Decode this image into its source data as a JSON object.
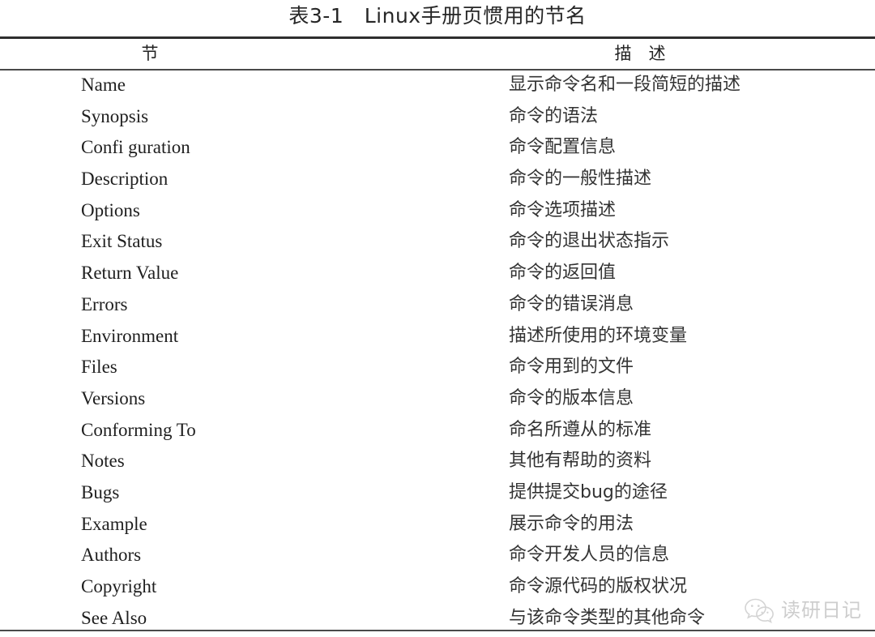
{
  "caption": "表3-1　Linux手册页惯用的节名",
  "table": {
    "headers": {
      "section": "节",
      "description": "描　述"
    },
    "rows": [
      {
        "section": "Name",
        "description": "显示命令名和一段简短的描述"
      },
      {
        "section": "Synopsis",
        "description": "命令的语法"
      },
      {
        "section": "Confi guration",
        "description": "命令配置信息"
      },
      {
        "section": "Description",
        "description": "命令的一般性描述"
      },
      {
        "section": "Options",
        "description": "命令选项描述"
      },
      {
        "section": "Exit Status",
        "description": "命令的退出状态指示"
      },
      {
        "section": "Return Value",
        "description": "命令的返回值"
      },
      {
        "section": "Errors",
        "description": "命令的错误消息"
      },
      {
        "section": "Environment",
        "description": "描述所使用的环境变量"
      },
      {
        "section": "Files",
        "description": "命令用到的文件"
      },
      {
        "section": "Versions",
        "description": "命令的版本信息"
      },
      {
        "section": "Conforming To",
        "description": "命名所遵从的标准"
      },
      {
        "section": "Notes",
        "description": "其他有帮助的资料"
      },
      {
        "section": "Bugs",
        "description": "提供提交bug的途径"
      },
      {
        "section": "Example",
        "description": "展示命令的用法"
      },
      {
        "section": "Authors",
        "description": "命令开发人员的信息"
      },
      {
        "section": "Copyright",
        "description": "命令源代码的版权状况"
      },
      {
        "section": "See Also",
        "description": "与该命令类型的其他命令"
      }
    ]
  },
  "watermark": {
    "icon": "wechat-bubble-icon",
    "text": "读研日记",
    "color": "#8a8a8a"
  },
  "colors": {
    "background": "#ffffff",
    "text": "#1f1f1f",
    "rule": "#3a3a3a"
  }
}
